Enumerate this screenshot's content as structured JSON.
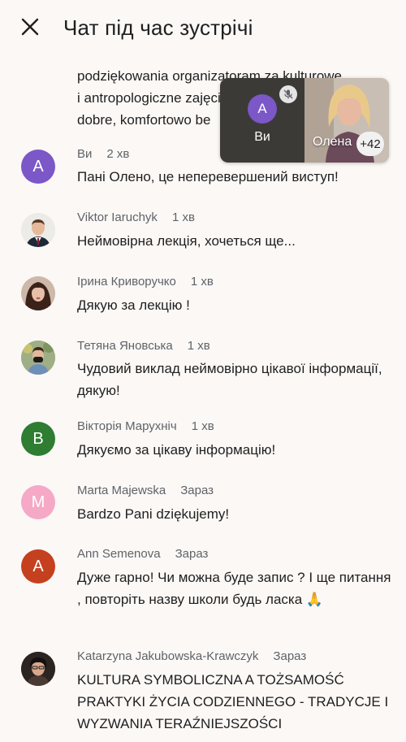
{
  "header": {
    "title": "Чат під час зустрічі"
  },
  "partial_message": {
    "lines": [
      "podziękowania organizatoram za kulturowe",
      "i antropologiczne zajęcia",
      "dobre, komfortowo be"
    ]
  },
  "pip": {
    "self": {
      "initial": "A",
      "name": "Ви",
      "avatar_color": "#7b57c8"
    },
    "other": {
      "name": "Олена",
      "count": "+42"
    }
  },
  "messages": [
    {
      "sender": "Ви",
      "time": "2 хв",
      "initial": "A",
      "avatar_color": "#7b57c8",
      "text": "Пані Олено, це неперевершений виступ!"
    },
    {
      "sender": "Viktor Iaruchyk",
      "time": "1 хв",
      "avatar_icon": "person-photo-icon",
      "text": "Неймовірна лекція, хочеться ще..."
    },
    {
      "sender": "Ірина Криворучко",
      "time": "1 хв",
      "avatar_icon": "person-photo-icon",
      "text": "Дякую за лекцію !"
    },
    {
      "sender": "Тетяна Яновська",
      "time": "1 хв",
      "avatar_icon": "person-photo-icon",
      "text": "Чудовий виклад неймовірно цікавої інформації, дякую!"
    },
    {
      "sender": "Вікторія Марухніч",
      "time": "1 хв",
      "initial": "В",
      "avatar_color": "#2e7d32",
      "text": "Дякуємо за цікаву інформацію!"
    },
    {
      "sender": "Marta Majewska",
      "time": "Зараз",
      "initial": "M",
      "avatar_color": "#f5a9c6",
      "text": "Bardzo Pani dziękujemy!"
    },
    {
      "sender": "Ann Semenova",
      "time": "Зараз",
      "initial": "A",
      "avatar_color": "#c5401f",
      "text": "Дуже гарно! Чи можна буде запис ? І ще питання , повторіть назву школи будь ласка 🙏"
    },
    {
      "sender": "Katarzyna Jakubowska-Krawczyk",
      "time": "Зараз",
      "avatar_icon": "person-photo-icon",
      "text": "KULTURA SYMBOLICZNA A TOŻSAMOŚĆ PRAKTYKI ŻYCIA CODZIENNEGO - TRADYCJE I WYZWANIA TERAŹNIEJSZOŚCI"
    }
  ]
}
